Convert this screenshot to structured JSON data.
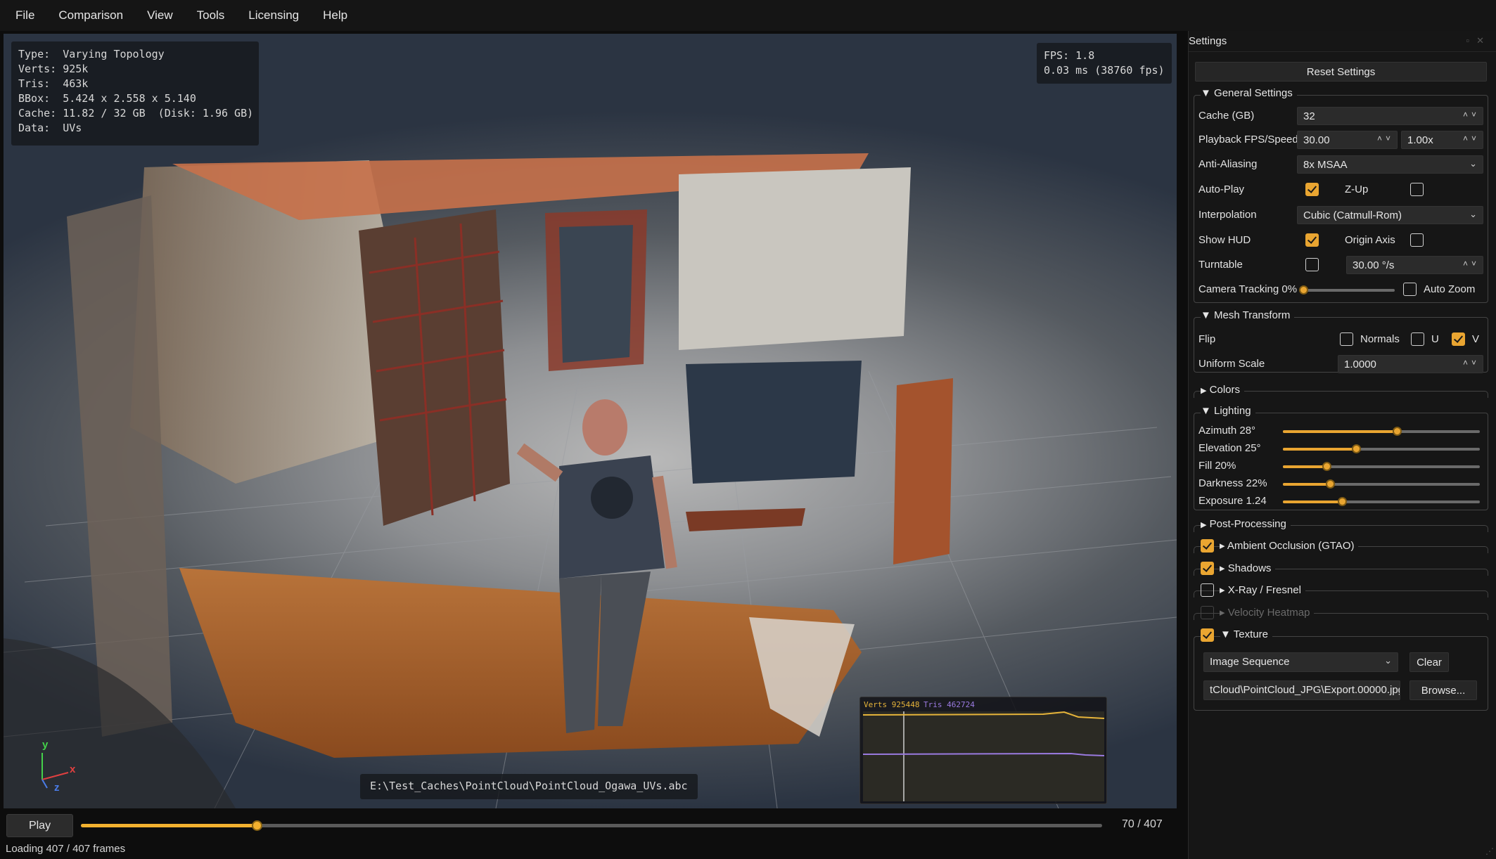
{
  "menu": [
    "File",
    "Comparison",
    "View",
    "Tools",
    "Licensing",
    "Help"
  ],
  "hud": {
    "stats": [
      {
        "label": "Type:",
        "value": "Varying Topology"
      },
      {
        "label": "Verts:",
        "value": "925k"
      },
      {
        "label": "Tris:",
        "value": "463k"
      },
      {
        "label": "BBox:",
        "value": "5.424 x 2.558 x 5.140"
      },
      {
        "label": "Cache:",
        "value": "11.82 / 32 GB  (Disk: 1.96 GB)"
      },
      {
        "label": "Data:",
        "value": "UVs"
      }
    ],
    "fps_line1": "FPS: 1.8",
    "fps_line2": "0.03 ms (38760 fps)",
    "file_path": "E:\\Test_Caches\\PointCloud\\PointCloud_Ogawa_UVs.abc",
    "graph": {
      "verts_label": "Verts 925448",
      "tris_label": "Tris 462724",
      "verts_color": "#e6b43a",
      "tris_color": "#9a7ae0"
    },
    "axes": {
      "y": "y",
      "x": "x",
      "z": "z"
    }
  },
  "timeline": {
    "play_label": "Play",
    "progress": 0.172,
    "frame_text": "70 / 407",
    "accent": "#f2b12f"
  },
  "status": "Loading 407 / 407 frames",
  "settings": {
    "title": "Settings",
    "reset_label": "Reset Settings",
    "general": {
      "header": "General Settings",
      "cache_label": "Cache (GB)",
      "cache_value": "32",
      "fps_label": "Playback FPS/Speed",
      "fps_value": "30.00",
      "speed_value": "1.00x",
      "aa_label": "Anti-Aliasing",
      "aa_value": "8x MSAA",
      "autoplay_label": "Auto-Play",
      "autoplay_checked": true,
      "zup_label": "Z-Up",
      "zup_checked": false,
      "interp_label": "Interpolation",
      "interp_value": "Cubic (Catmull-Rom)",
      "showhud_label": "Show HUD",
      "showhud_checked": true,
      "originaxis_label": "Origin Axis",
      "originaxis_checked": false,
      "turntable_label": "Turntable",
      "turntable_checked": false,
      "turntable_value": "30.00 °/s",
      "camtrack_label": "Camera Tracking 0%",
      "camtrack_value": 0,
      "autozoom_label": "Auto Zoom",
      "autozoom_checked": false
    },
    "mesh": {
      "header": "Mesh Transform",
      "flip_label": "Flip",
      "normals_label": "Normals",
      "normals_checked": false,
      "u_label": "U",
      "u_checked": false,
      "v_label": "V",
      "v_checked": true,
      "scale_label": "Uniform Scale",
      "scale_value": "1.0000"
    },
    "colors_header": "Colors",
    "lighting": {
      "header": "Lighting",
      "sliders": [
        {
          "label": "Azimuth 28°",
          "value": 0.58
        },
        {
          "label": "Elevation 25°",
          "value": 0.37
        },
        {
          "label": "Fill 20%",
          "value": 0.22
        },
        {
          "label": "Darkness 22%",
          "value": 0.24
        },
        {
          "label": "Exposure 1.24",
          "value": 0.3
        }
      ]
    },
    "post_header": "Post-Processing",
    "post_items": [
      {
        "label": "Ambient Occlusion (GTAO)",
        "checked": true,
        "dim": false
      },
      {
        "label": "Shadows",
        "checked": true,
        "dim": false
      },
      {
        "label": "X-Ray / Fresnel",
        "checked": false,
        "dim": false
      },
      {
        "label": "Velocity Heatmap",
        "checked": false,
        "dim": true
      }
    ],
    "texture": {
      "header": "Texture",
      "checked": true,
      "source_value": "Image Sequence",
      "clear_label": "Clear",
      "path_value": "tCloud\\PointCloud_JPG\\Export.00000.jpg",
      "browse_label": "Browse..."
    }
  }
}
